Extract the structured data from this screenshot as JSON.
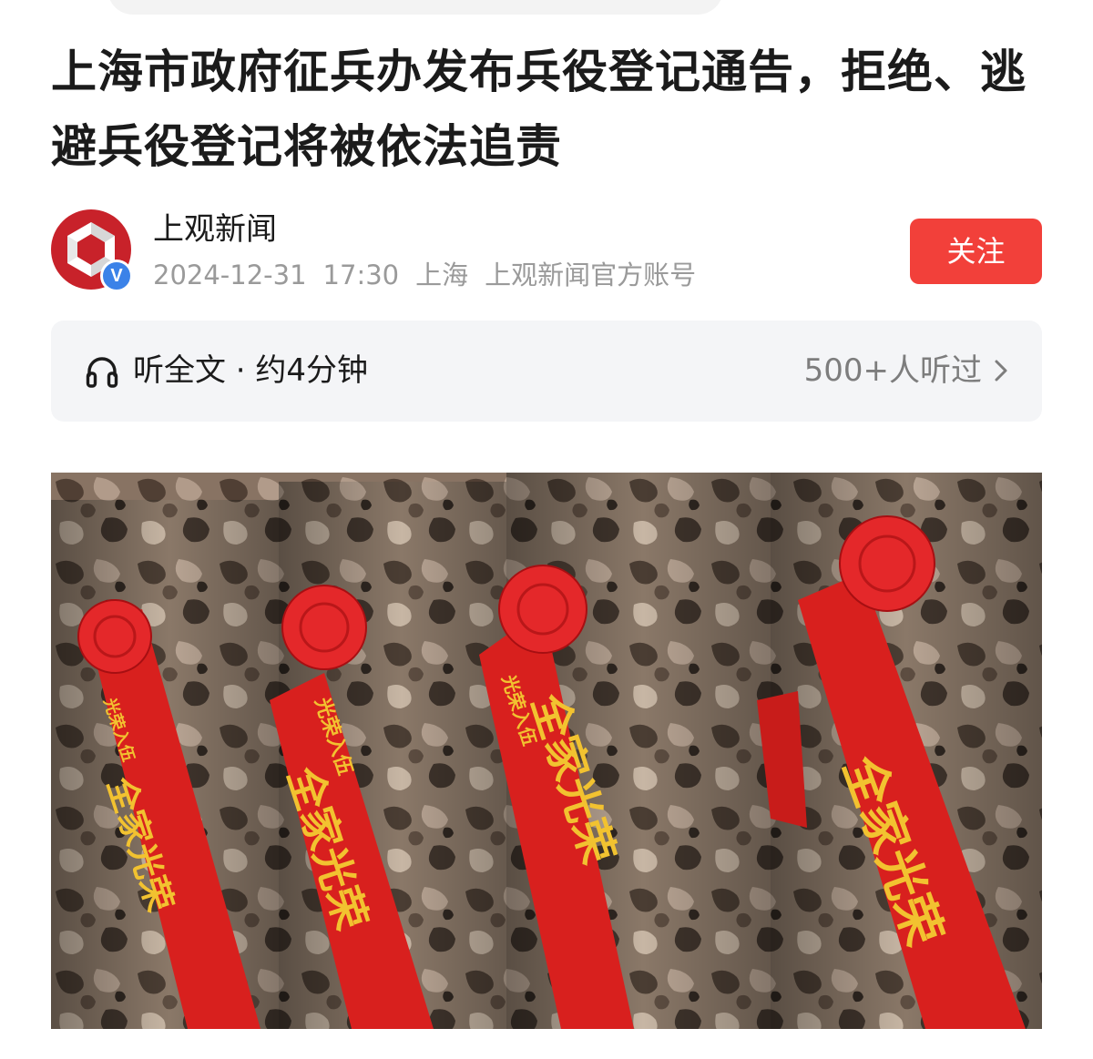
{
  "article": {
    "title": "上海市政府征兵办发布兵役登记通告，拒绝、逃避兵役登记将被依法追责"
  },
  "author": {
    "name": "上观新闻",
    "date": "2024-12-31",
    "time": "17:30",
    "location": "上海",
    "account_type": "上观新闻官方账号",
    "verified_badge": "V",
    "follow_label": "关注"
  },
  "listen": {
    "label": "听全文 · 约4分钟",
    "count": "500+人听过"
  },
  "hero": {
    "sash_text_large": "全家光荣",
    "sash_text_small": "光荣入伍"
  },
  "colors": {
    "accent": "#f2403a",
    "verified": "#3b82e8",
    "sash_red": "#d8201e",
    "sash_gold": "#f2c230"
  },
  "icons": {
    "listen": "headphone-icon",
    "more": "chevron-right-icon"
  }
}
